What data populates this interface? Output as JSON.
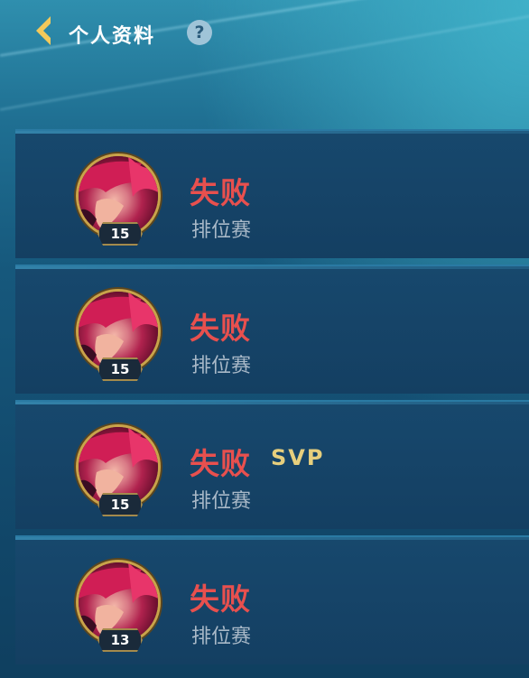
{
  "header": {
    "title": "个人资料",
    "help_symbol": "?"
  },
  "matches": [
    {
      "result": "失败",
      "mode": "排位赛",
      "level": "15",
      "badge": ""
    },
    {
      "result": "失败",
      "mode": "排位赛",
      "level": "15",
      "badge": ""
    },
    {
      "result": "失败",
      "mode": "排位赛",
      "level": "15",
      "badge": "SVP"
    },
    {
      "result": "失败",
      "mode": "排位赛",
      "level": "13",
      "badge": ""
    }
  ],
  "colors": {
    "defeat": "#e8504e",
    "svp": "#e7cf7d",
    "mode_text": "#a9b9c8",
    "avatar_ring": "#c9a34a"
  }
}
